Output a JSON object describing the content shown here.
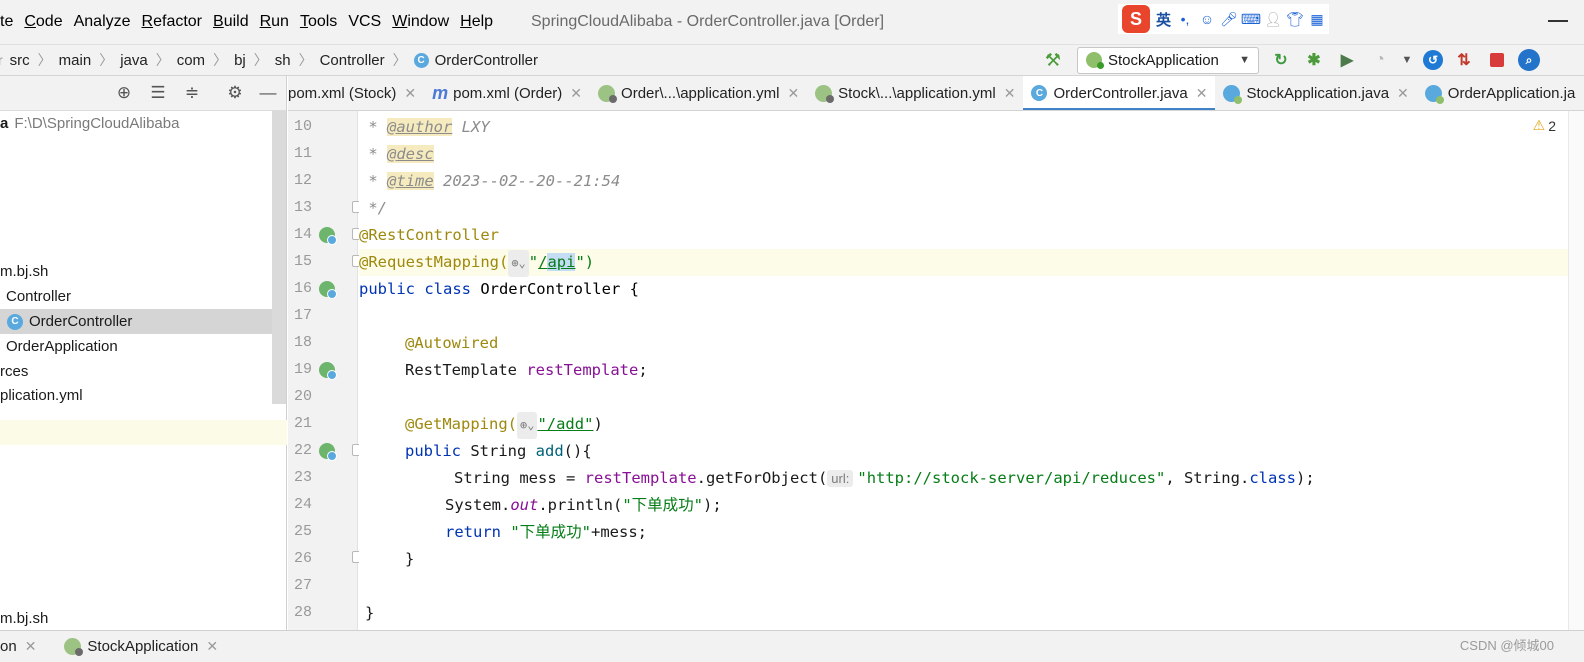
{
  "menubar": {
    "items": [
      {
        "label": "te",
        "mnemonic": ""
      },
      {
        "mnemonic": "C",
        "rest": "ode"
      },
      {
        "label": "Analyze",
        "mnemonic": "",
        "u": "A",
        "r": "nalyze"
      },
      {
        "mnemonic": "R",
        "rest": "efactor"
      },
      {
        "mnemonic": "B",
        "rest": "uild"
      },
      {
        "mnemonic": "R",
        "rest": "un"
      },
      {
        "mnemonic": "T",
        "rest": "ools"
      },
      {
        "label": "VCS"
      },
      {
        "mnemonic": "W",
        "rest": "indow"
      },
      {
        "mnemonic": "H",
        "rest": "elp"
      }
    ],
    "window_title": "SpringCloudAlibaba - OrderController.java [Order]",
    "ime": {
      "logo": "S",
      "lang": "英",
      "punct": "•,"
    }
  },
  "breadcrumb": {
    "items": [
      "src",
      "main",
      "java",
      "com",
      "bj",
      "sh",
      "Controller",
      "OrderController"
    ],
    "leading_sep": "r"
  },
  "run_toolbar": {
    "config_name": "StockApplication"
  },
  "project_tree": {
    "rows": [
      {
        "text": "a",
        "path": "F:\\D\\SpringCloudAlibaba"
      },
      {
        "text": "m.bj.sh"
      },
      {
        "text": "Controller"
      },
      {
        "text": "OrderController"
      },
      {
        "text": "OrderApplication"
      },
      {
        "text": "rces"
      },
      {
        "text": "plication.yml"
      },
      {
        "text": "m.bj.sh"
      }
    ]
  },
  "tabs": [
    {
      "label": "pom.xml (Stock)"
    },
    {
      "label": "pom.xml (Order)",
      "prefix": "m"
    },
    {
      "label": "Order\\...\\application.yml"
    },
    {
      "label": "Stock\\...\\application.yml"
    },
    {
      "label": "OrderController.java",
      "active": true
    },
    {
      "label": "StockApplication.java"
    },
    {
      "label": "OrderApplication.ja"
    }
  ],
  "editor": {
    "line_numbers": [
      "10",
      "11",
      "12",
      "13",
      "14",
      "15",
      "16",
      "17",
      "18",
      "19",
      "20",
      "21",
      "22",
      "23",
      "24",
      "25",
      "26",
      "27",
      "28"
    ],
    "warning_count": "2",
    "code": {
      "l10_star": " * ",
      "l10_tag": "@author",
      "l10_val": " LXY",
      "l11_star": " * ",
      "l11_tag": "@desc",
      "l12_star": " * ",
      "l12_tag": "@time",
      "l12_val": " 2023--02--20--21:54",
      "l13": " */",
      "l14": "@RestController",
      "l15_ann": "@RequestMapping(",
      "l15_globe": "⊕⌄",
      "l15_q1": "\"",
      "l15_slash": "/",
      "l15_api": "api",
      "l15_end": "\")",
      "l16_kw": "public class",
      "l16_rest": " OrderController {",
      "l18": "@Autowired",
      "l19_type": "RestTemplate ",
      "l19_field": "restTemplate",
      "l19_end": ";",
      "l21_ann": "@GetMapping(",
      "l21_globe": "⊕⌄",
      "l21_str": "\"/add\"",
      "l21_end": ")",
      "l22_kw": "public",
      "l22_type": " String ",
      "l22_m": "add",
      "l22_end": "(){",
      "l23_a": "String mess = ",
      "l23_field": "restTemplate",
      "l23_b": ".getForObject(",
      "l23_hint": "url:",
      "l23_str": "\"http://stock-server/api/reduces\"",
      "l23_c": ", String.",
      "l23_kw": "class",
      "l23_d": ");",
      "l24_a": "System.",
      "l24_out": "out",
      "l24_b": ".println(",
      "l24_str": "\"下单成功\"",
      "l24_c": ");",
      "l25_kw": "return ",
      "l25_str": "\"下单成功\"",
      "l25_rest": "+mess;",
      "l26": "}",
      "l28": "}"
    }
  },
  "bottom": {
    "tab1": "on",
    "tab2": "StockApplication",
    "watermark": "CSDN @倾城00"
  }
}
